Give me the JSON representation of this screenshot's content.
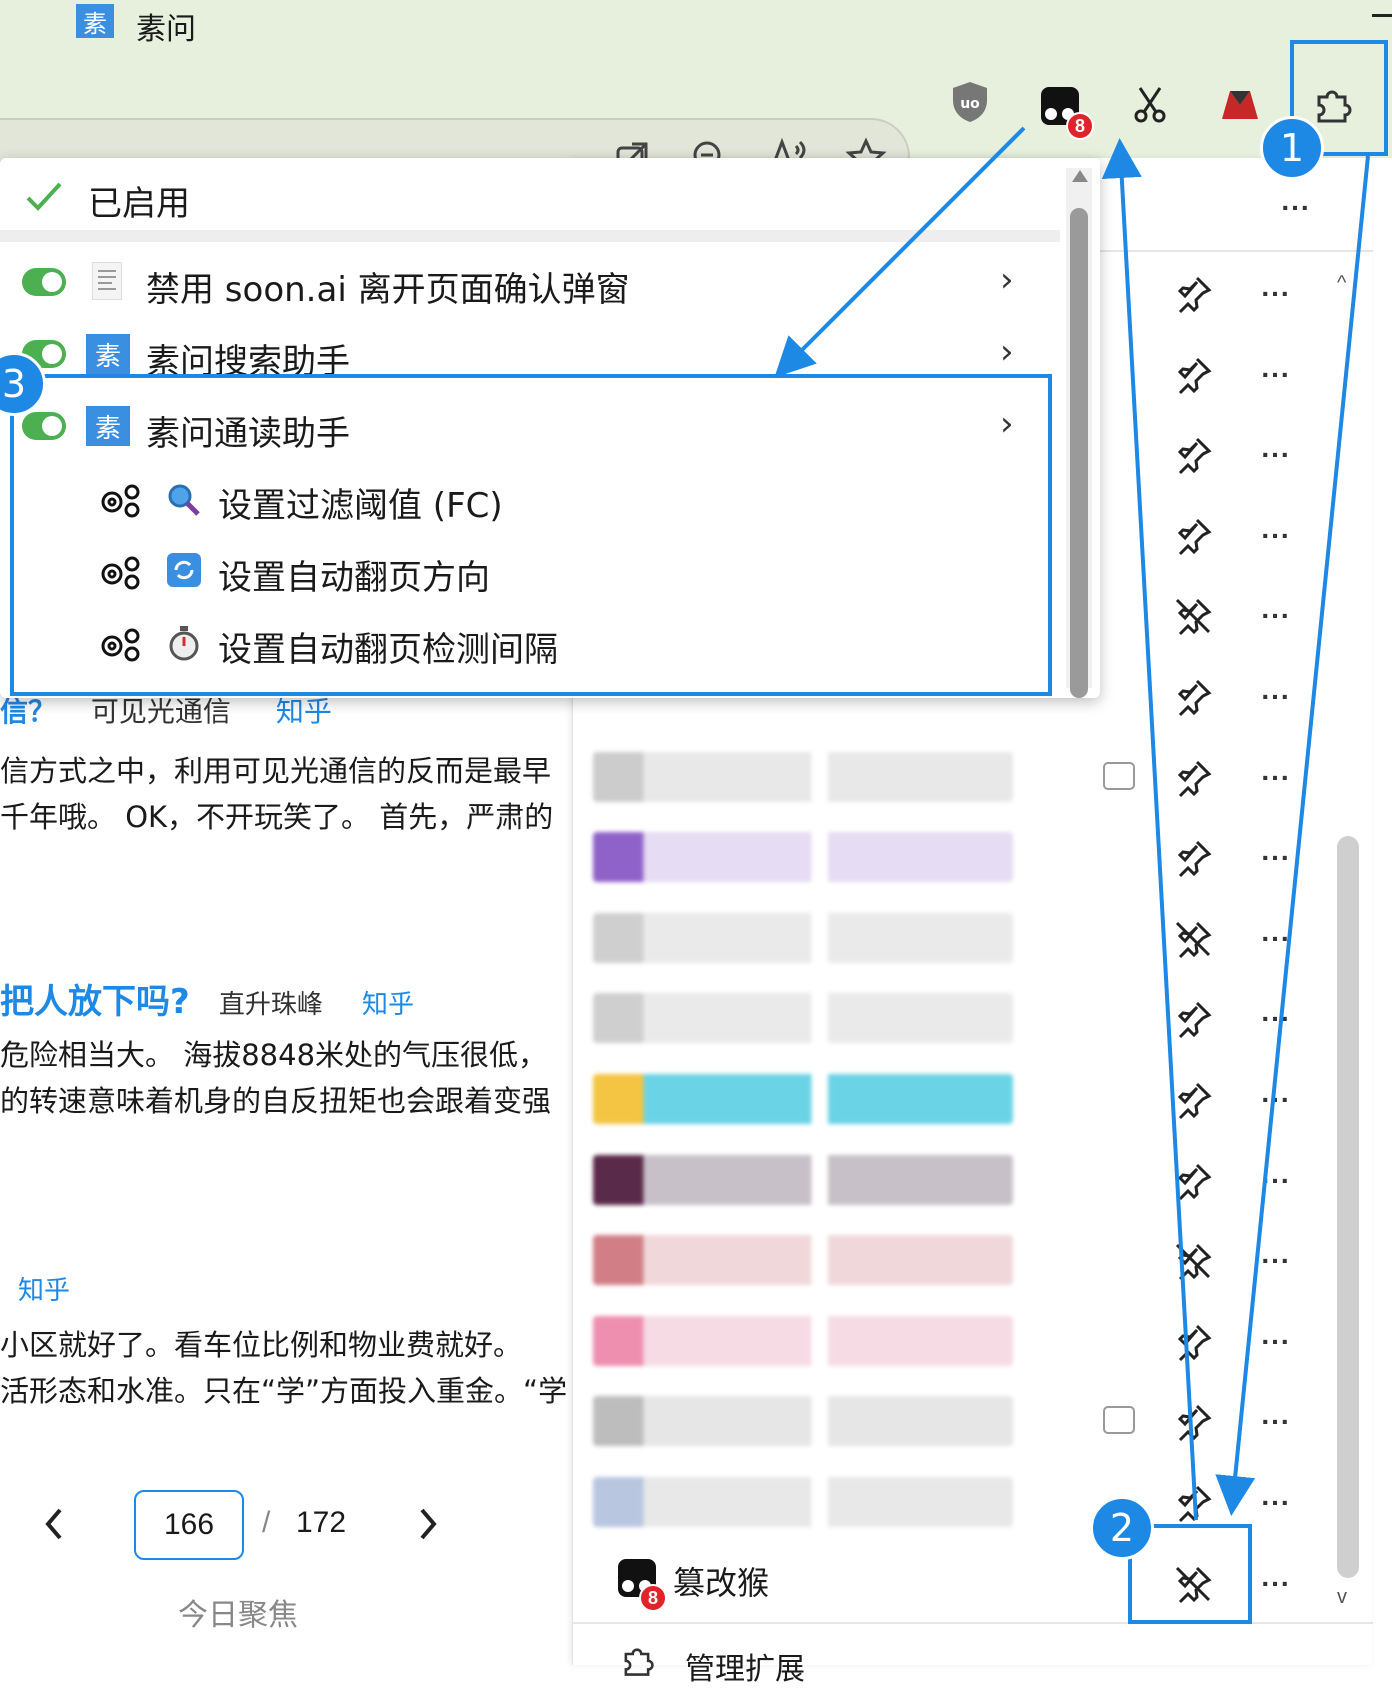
{
  "browser": {
    "tab_favicon": "素",
    "tab_title": "素问",
    "address_icons": [
      "open-in-new-icon",
      "zoom-out-icon",
      "read-aloud-icon",
      "favorite-star-icon"
    ],
    "extension_badge": "8"
  },
  "menu": {
    "section_title": "已启用",
    "items": [
      {
        "label": "禁用 soon.ai 离开页面确认弹窗"
      },
      {
        "favicon": "素",
        "label": "素问搜索助手"
      },
      {
        "favicon": "素",
        "label": "素问通读助手"
      }
    ],
    "subitems": [
      {
        "label": "设置过滤阈值 (FC)"
      },
      {
        "label": "设置自动翻页方向"
      },
      {
        "label": "设置自动翻页检测间隔"
      }
    ]
  },
  "extensions_panel": {
    "last_item_label": "篡改猴",
    "last_item_badge": "8",
    "footer_label": "管理扩展",
    "more_label": "..."
  },
  "content": {
    "a1": {
      "title_part": "信？",
      "author": "可见光通信",
      "source": "知乎"
    },
    "a1_lines": [
      "信方式之中，利用可见光通信的反而是最早",
      "千年哦。 OK，不开玩笑了。 首先，严肃的"
    ],
    "a2": {
      "title_part": "把人放下吗?",
      "author": "直升珠峰",
      "source": "知乎"
    },
    "a2_lines": [
      "危险相当大。 海拔8848米处的气压很低，",
      "的转速意味着机身的自反扭矩也会跟着变强"
    ],
    "a3": {
      "source": "知乎"
    },
    "a3_lines": [
      "小区就好了。看车位比例和物业费就好。",
      "活形态和水准。只在“学”方面投入重金。“学"
    ]
  },
  "pagination": {
    "current": "166",
    "separator": "/",
    "total": "172",
    "footer": "今日聚焦"
  },
  "annotations": {
    "c1": "1",
    "c2": "2",
    "c3": "3"
  },
  "colors": {
    "accent": "#1e88e5",
    "toggle_on": "#4caf50",
    "badge": "#e0242a",
    "toolbar_bg": "#e7f0dd"
  }
}
